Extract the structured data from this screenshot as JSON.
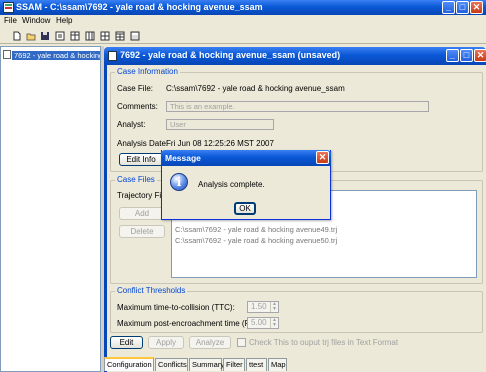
{
  "app": {
    "title": "SSAM - C:\\ssam\\7692 - yale road & hocking avenue_ssam"
  },
  "menu": [
    "File",
    "Window",
    "Help"
  ],
  "tree": {
    "item": "7692 - yale road & hocking"
  },
  "frame": {
    "title": "7692 - yale road & hocking avenue_ssam (unsaved)"
  },
  "case_info": {
    "title": "Case Information",
    "case_file_label": "Case File:",
    "case_file_value": "C:\\ssam\\7692 - yale road & hocking avenue_ssam",
    "comments_label": "Comments:",
    "comments_placeholder": "This is an example.",
    "analyst_label": "Analyst:",
    "analyst_value": "User",
    "date_label": "Analysis Date:",
    "date_value": "Fri Jun 08 12:25:26 MST 2007",
    "edit_info": "Edit Info"
  },
  "case_files": {
    "title": "Case Files",
    "trajectory_label": "Trajectory Files",
    "add": "Add",
    "delete": "Delete",
    "files": [
      "C:\\ssam\\7692 - yale road & hocking avenue49.trj",
      "C:\\ssam\\7692 - yale road & hocking avenue50.trj"
    ]
  },
  "thresholds": {
    "title": "Conflict Thresholds",
    "ttc_label": "Maximum time-to-collision (TTC):",
    "ttc_value": "1.50",
    "pet_label": "Maximum post-encroachment time (PET):",
    "pet_value": "5.00"
  },
  "actions": {
    "edit": "Edit",
    "apply": "Apply",
    "analyze": "Analyze",
    "checkbox_label": "Check This to ouput trj files in Text Format"
  },
  "tabs": [
    "Configuration",
    "Conflicts",
    "Summary",
    "Filter",
    "ttest",
    "Map"
  ],
  "dialog": {
    "title": "Message",
    "message": "Analysis complete.",
    "ok": "OK"
  },
  "colors": {
    "title_blue": "#0a58d6",
    "group_title": "#0046d5",
    "close_red": "#c83a16"
  }
}
